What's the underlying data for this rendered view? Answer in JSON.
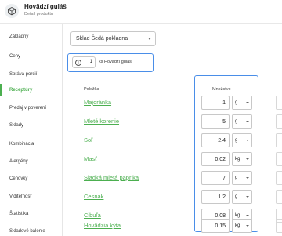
{
  "header": {
    "title": "Hovädzí guláš",
    "subtitle": "Detail produktu"
  },
  "sidebar": {
    "items": [
      {
        "label": "Základný",
        "active": false
      },
      {
        "label": "Ceny",
        "active": false
      },
      {
        "label": "Správa porcií",
        "active": false
      },
      {
        "label": "Receptúry",
        "active": true
      },
      {
        "label": "Predaj v poverení",
        "active": false
      },
      {
        "label": "Sklady",
        "active": false
      },
      {
        "label": "Kombinácia",
        "active": false
      },
      {
        "label": "Alergény",
        "active": false
      },
      {
        "label": "Cenovky",
        "active": false
      },
      {
        "label": "Viditeľnosť",
        "active": false
      },
      {
        "label": "Štatistika",
        "active": false
      },
      {
        "label": "Skladové balenie",
        "active": false
      }
    ]
  },
  "warehouse": {
    "selected": "Sklad Šedá pokladna"
  },
  "batch": {
    "info_icon": "i",
    "quantity": "1",
    "label": "ks Hovädzí guláš"
  },
  "table": {
    "columns": {
      "ingredient": "Položka",
      "quantity": "Množstvo"
    },
    "rows": [
      {
        "name": "Majoránka",
        "qty": "1",
        "unit": "g"
      },
      {
        "name": "Mleté korenie",
        "qty": "5",
        "unit": "g"
      },
      {
        "name": "Soľ",
        "qty": "2.4",
        "unit": "g"
      },
      {
        "name": "Masť",
        "qty": "0.02",
        "unit": "kg"
      },
      {
        "name": "Sladká mletá paprika",
        "qty": "7",
        "unit": "g"
      },
      {
        "name": "Cesnak",
        "qty": "1.2",
        "unit": "g"
      },
      {
        "name": "Cibuľa",
        "qty": "0.08",
        "unit": "kg"
      },
      {
        "name": "Hovädzia kýta",
        "qty": "0.15",
        "unit": "kg"
      }
    ]
  },
  "colors": {
    "accent": "#4caf50",
    "highlight": "#4a8ee8"
  }
}
